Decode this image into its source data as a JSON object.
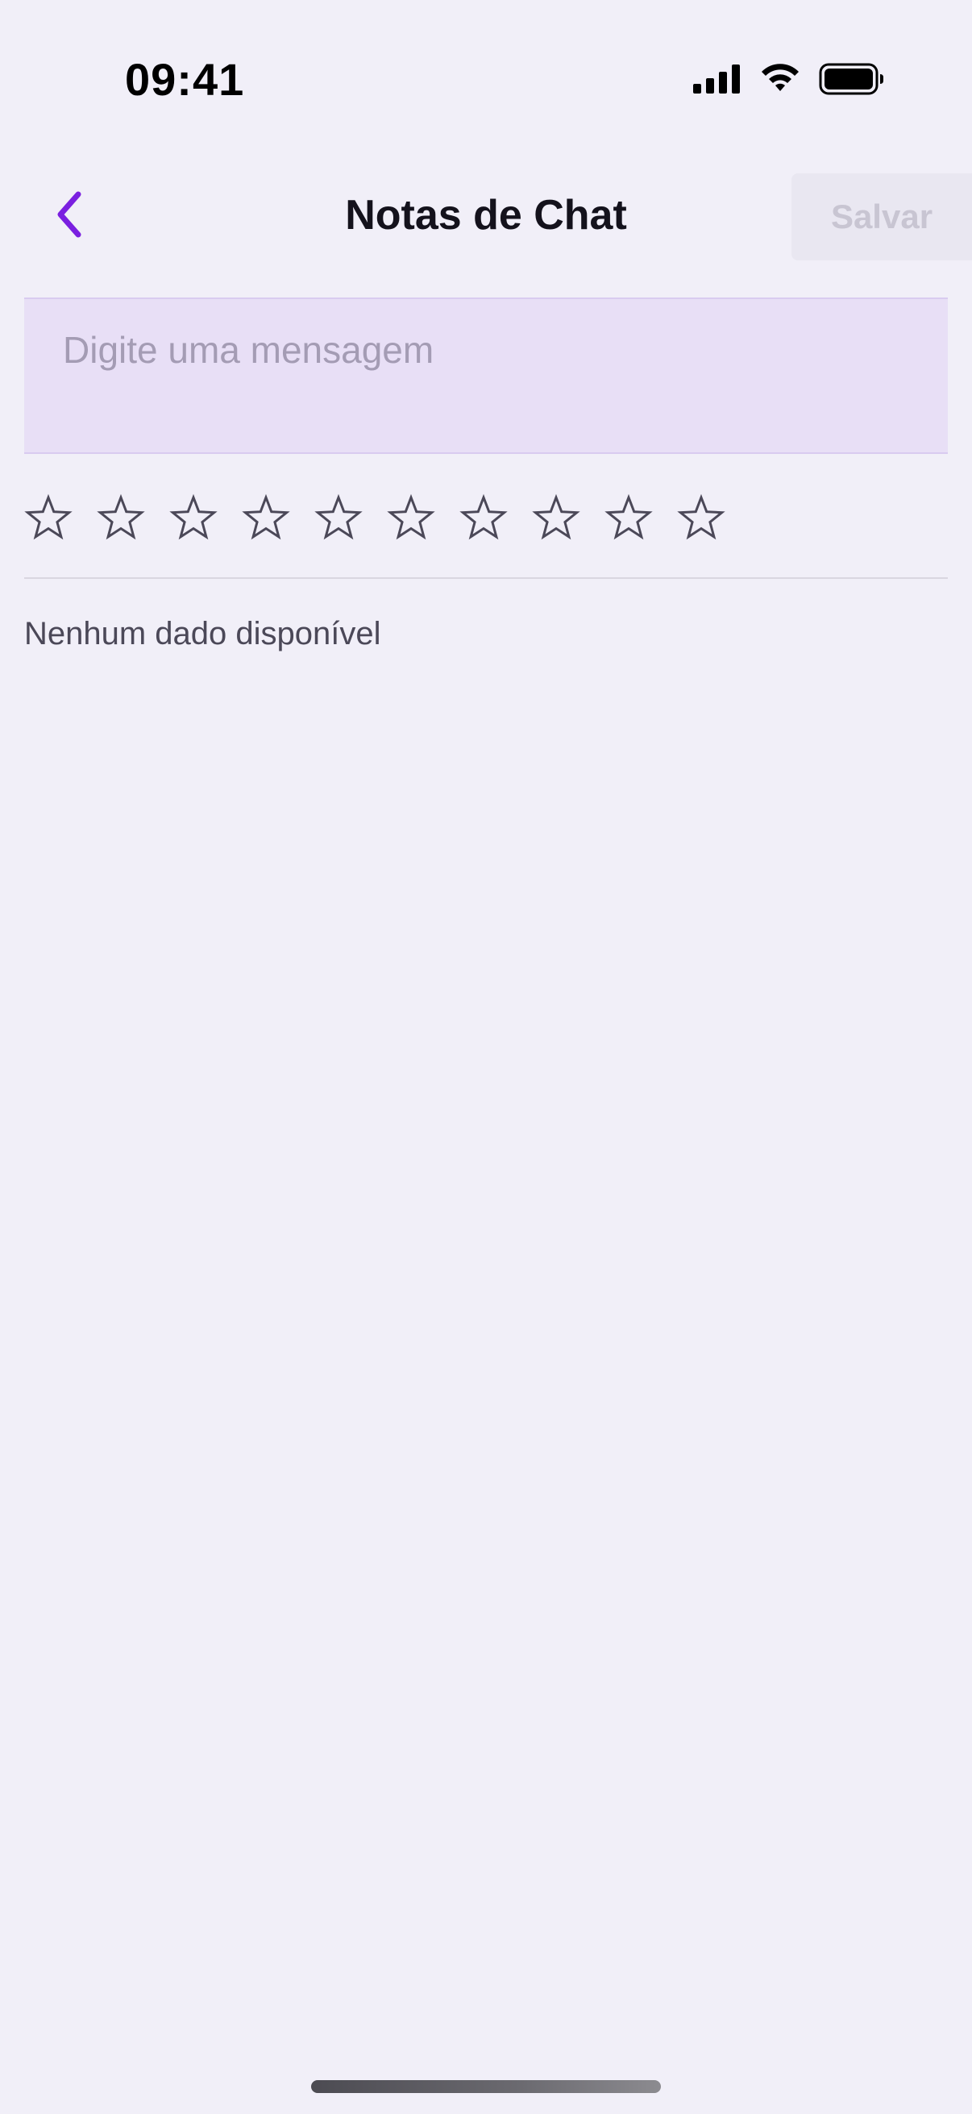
{
  "status_bar": {
    "time": "09:41",
    "signal_icon": "cellular-signal-icon",
    "wifi_icon": "wifi-icon",
    "battery_icon": "battery-icon"
  },
  "header": {
    "back_icon": "chevron-left-icon",
    "title": "Notas de Chat",
    "save_label": "Salvar"
  },
  "message": {
    "placeholder": "Digite uma mensagem",
    "value": ""
  },
  "rating": {
    "max": 10,
    "value": 0,
    "star_icon": "star-outline-icon"
  },
  "notes": {
    "empty_text": "Nenhum dado disponível"
  },
  "colors": {
    "background": "#f1eff8",
    "accent": "#7a1fe0",
    "input_background": "#e8dff6",
    "save_button_background": "#e9e7f1",
    "save_button_text_disabled": "#c8c5d2",
    "star_stroke": "#4b4858"
  }
}
